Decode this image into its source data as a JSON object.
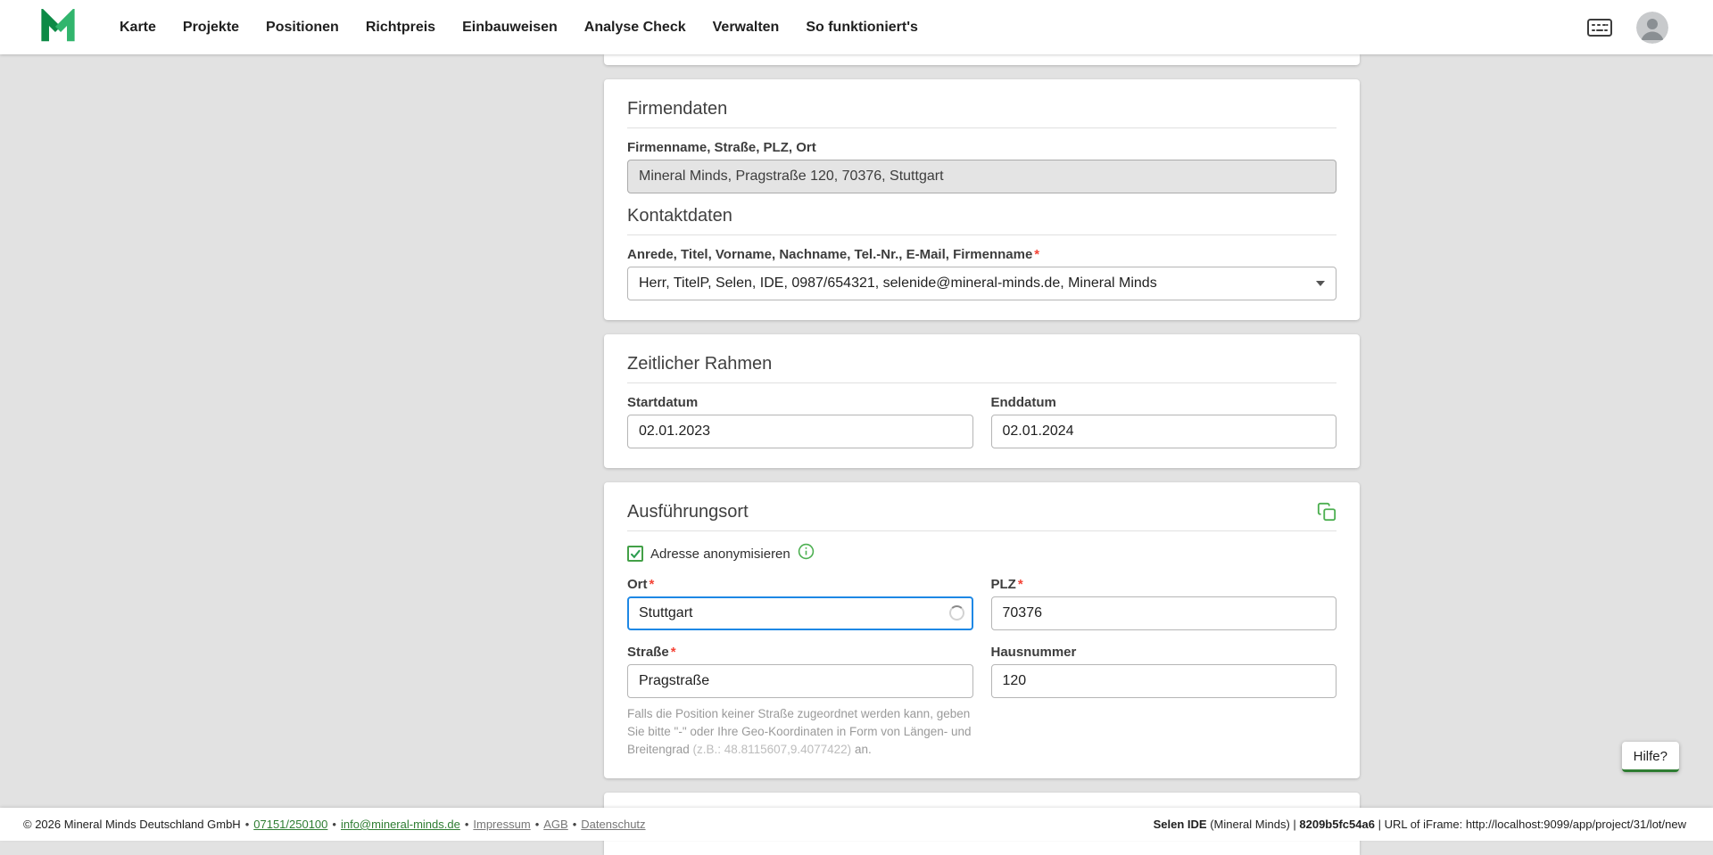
{
  "colors": {
    "accent_green": "#1fa05a",
    "focus_blue": "#1e88e5",
    "asterisk_red": "#f44336"
  },
  "required_marker": "*",
  "nav": {
    "items": [
      "Karte",
      "Projekte",
      "Positionen",
      "Richtpreis",
      "Einbauweisen",
      "Analyse Check",
      "Verwalten",
      "So funktioniert's"
    ]
  },
  "company_card": {
    "title": "Firmendaten",
    "company_label": "Firmenname, Straße, PLZ, Ort",
    "company_value": "Mineral Minds, Pragstraße 120, 70376, Stuttgart",
    "contact_title": "Kontaktdaten",
    "contact_label": "Anrede, Titel, Vorname, Nachname, Tel.-Nr., E-Mail, Firmenname",
    "contact_value": "Herr, TitelP, Selen, IDE, 0987/654321, selenide@mineral-minds.de, Mineral Minds"
  },
  "timeframe_card": {
    "title": "Zeitlicher Rahmen",
    "start_label": "Startdatum",
    "start_value": "02.01.2023",
    "end_label": "Enddatum",
    "end_value": "02.01.2024"
  },
  "location_card": {
    "title": "Ausführungsort",
    "anonymize_label": "Adresse anonymisieren",
    "city_label": "Ort",
    "city_value": "Stuttgart",
    "zip_label": "PLZ",
    "zip_value": "70376",
    "street_label": "Straße",
    "street_value": "Pragstraße",
    "house_number_label": "Hausnummer",
    "house_number_value": "120",
    "street_hint": "Falls die Position keiner Straße zugeordnet werden kann, geben Sie bitte \"-\" oder Ihre Geo-Koordinaten in Form von Längen- und Breitengrad ",
    "street_hint_example": "(z.B.: 48.8115607,9.4077422)",
    "street_hint_suffix": " an."
  },
  "help_button_label": "Hilfe?",
  "footer": {
    "copyright": "© 2026 Mineral Minds Deutschland GmbH",
    "separator": "•",
    "phone_link": "07151/250100",
    "email_link": "info@mineral-minds.de",
    "impressum_link": "Impressum",
    "agb_link": "AGB",
    "datenschutz_link": "Datenschutz",
    "right_segments": [
      {
        "text": "Selen IDE",
        "bold": true
      },
      {
        "text": " (Mineral Minds) | ",
        "bold": false
      },
      {
        "text": "8209b5fc54a6",
        "bold": true
      },
      {
        "text": " | URL of iFrame: http://localhost:9099/app/project/31/lot/new",
        "bold": false
      }
    ]
  }
}
